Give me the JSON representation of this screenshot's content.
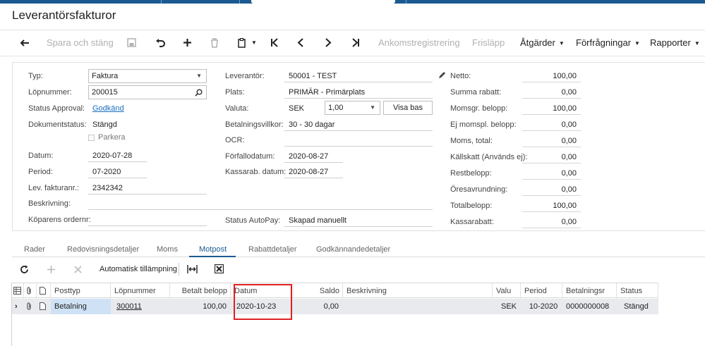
{
  "page": {
    "title": "Leverantörsfakturor"
  },
  "toolbar": {
    "save_close": "Spara och stäng",
    "arrival_registration": "Ankomstregistrering",
    "release": "Frisläpp",
    "actions": "Åtgärder",
    "inquiries": "Förfrågningar",
    "reports": "Rapporter"
  },
  "form": {
    "typ_label": "Typ:",
    "typ_value": "Faktura",
    "lopnummer_label": "Löpnummer:",
    "lopnummer_value": "200015",
    "status_approval_label": "Status Approval:",
    "status_approval_value": "Godkänd",
    "dokumentstatus_label": "Dokumentstatus:",
    "dokumentstatus_value": "Stängd",
    "parkera_label": "Parkera",
    "datum_label": "Datum:",
    "datum_value": "2020-07-28",
    "period_label": "Period:",
    "period_value": "07-2020",
    "lev_fakturanr_label": "Lev. fakturanr.:",
    "lev_fakturanr_value": "2342342",
    "beskrivning_label": "Beskrivning:",
    "koparens_ordernr_label": "Köparens ordernr:",
    "leverantor_label": "Leverantör:",
    "leverantor_value": "50001 - TEST",
    "plats_label": "Plats:",
    "plats_value": "PRIMÄR - Primärplats",
    "valuta_label": "Valuta:",
    "valuta_value": "SEK",
    "valuta_rate": "1,00",
    "visa_bas": "Visa bas",
    "betalningsvillkor_label": "Betalningsvillkor:",
    "betalningsvillkor_value": "30 - 30 dagar",
    "ocr_label": "OCR:",
    "forfallodatum_label": "Förfallodatum:",
    "forfallodatum_value": "2020-08-27",
    "kassarab_datum_label": "Kassarab. datum:",
    "kassarab_datum_value": "2020-08-27",
    "status_autopay_label": "Status AutoPay:",
    "status_autopay_value": "Skapad manuellt"
  },
  "totals": [
    {
      "label": "Netto:",
      "value": "100,00"
    },
    {
      "label": "Summa rabatt:",
      "value": "0,00"
    },
    {
      "label": "Momsgr. belopp:",
      "value": "100,00"
    },
    {
      "label": "Ej momspl. belopp:",
      "value": "0,00"
    },
    {
      "label": "Moms, total:",
      "value": "0,00"
    },
    {
      "label": "Källskatt (Används ej):",
      "value": "0,00"
    },
    {
      "label": "Restbelopp:",
      "value": "0,00"
    },
    {
      "label": "Öresavrundning:",
      "value": "0,00"
    },
    {
      "label": "Totalbelopp:",
      "value": "100,00"
    },
    {
      "label": "Kassarabatt:",
      "value": "0,00"
    }
  ],
  "tabs": [
    "Rader",
    "Redovisningsdetaljer",
    "Moms",
    "Motpost",
    "Rabattdetaljer",
    "Godkännandedetaljer"
  ],
  "gridbar": {
    "auto_apply": "Automatisk tillämpning"
  },
  "grid": {
    "columns": [
      "Posttyp",
      "Löpnummer",
      "Betalt belopp",
      "Datum",
      "Saldo",
      "Beskrivning",
      "Valu",
      "Period",
      "Betalningsr",
      "Status"
    ],
    "rows": [
      {
        "posttyp": "Betalning",
        "lopnummer": "300011",
        "betalt": "100,00",
        "datum": "2020-10-23",
        "saldo": "0,00",
        "beskrivning": "",
        "valuta": "SEK",
        "period": "10-2020",
        "betalningsref": "0000000008",
        "status": "Stängd"
      }
    ]
  }
}
